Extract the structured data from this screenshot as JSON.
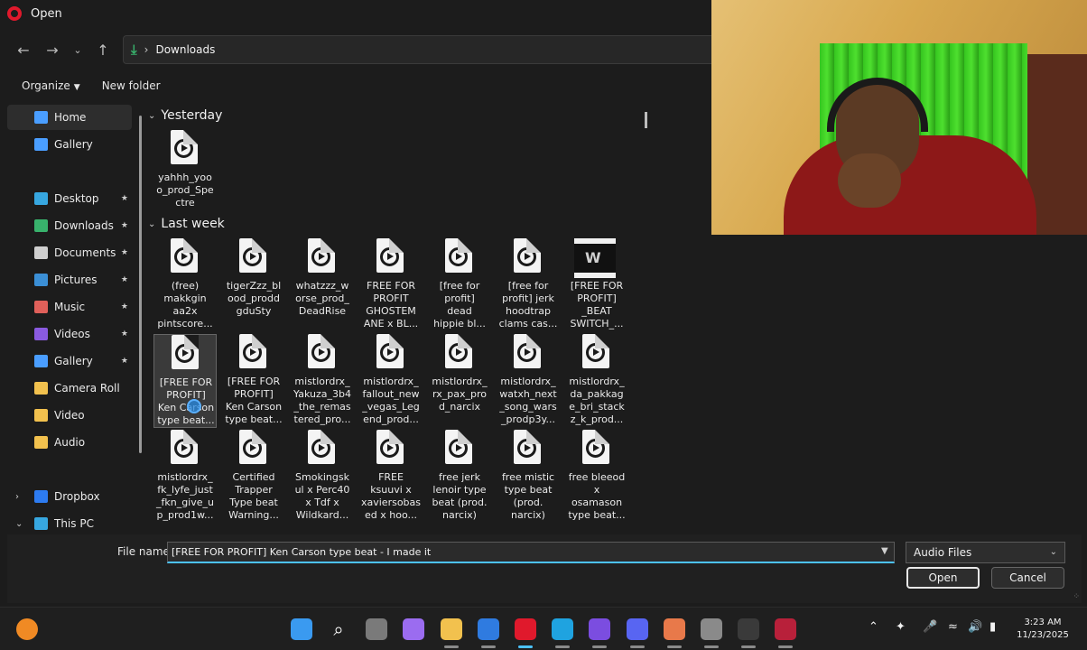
{
  "window": {
    "title": "Open"
  },
  "address": {
    "path": "Downloads"
  },
  "commandbar": {
    "organize": "Organize",
    "new_folder": "New folder"
  },
  "sidebar": {
    "items": [
      {
        "label": "Home",
        "icon": "home-icon",
        "color": "#4a9eff",
        "pinned": false,
        "selected": true
      },
      {
        "label": "Gallery",
        "icon": "gallery-icon",
        "color": "#4a9eff",
        "pinned": false
      },
      {
        "label": "Desktop",
        "icon": "desktop-icon",
        "color": "#37a7e0",
        "pinned": true
      },
      {
        "label": "Downloads",
        "icon": "download-icon",
        "color": "#38b26c",
        "pinned": true
      },
      {
        "label": "Documents",
        "icon": "documents-icon",
        "color": "#cfcfcf",
        "pinned": true
      },
      {
        "label": "Pictures",
        "icon": "pictures-icon",
        "color": "#3b8fd6",
        "pinned": true
      },
      {
        "label": "Music",
        "icon": "music-icon",
        "color": "#e0605a",
        "pinned": true
      },
      {
        "label": "Videos",
        "icon": "videos-icon",
        "color": "#8a5ae0",
        "pinned": true
      },
      {
        "label": "Gallery",
        "icon": "gallery-icon",
        "color": "#4a9eff",
        "pinned": true
      },
      {
        "label": "Camera Roll",
        "icon": "folder-icon",
        "color": "#f2c14e",
        "pinned": false
      },
      {
        "label": "Video",
        "icon": "folder-icon",
        "color": "#f2c14e",
        "pinned": false
      },
      {
        "label": "Audio",
        "icon": "folder-icon",
        "color": "#f2c14e",
        "pinned": false
      },
      {
        "label": "Dropbox",
        "icon": "dropbox-icon",
        "color": "#2d7bf0",
        "pinned": false,
        "expander": "collapsed"
      },
      {
        "label": "This PC",
        "icon": "pc-icon",
        "color": "#37a7e0",
        "pinned": false,
        "expander": "expanded"
      }
    ]
  },
  "groups": [
    {
      "title": "Yesterday",
      "files": [
        "yahhh_yoo\no_prod_Spe\nctre"
      ]
    },
    {
      "title": "Last week",
      "files": [
        "(free)\nmakkgin\naa2x\npintscore...",
        "tigerZzz_bl\nood_prodd\ngduSty",
        "whatzzz_w\norse_prod_\nDeadRise",
        "FREE FOR\nPROFIT\nGHOSTEM\nANE x BL...",
        "[free for\nprofit]\ndead\nhippie bl...",
        "[free for\nprofit] jerk\nhoodtrap\nclams cas...",
        "[FREE FOR\nPROFIT]\n_BEAT\nSWITCH_...",
        "[FREE FOR\nPROFIT]\nKen Carson\ntype beat...",
        "[FREE FOR\nPROFIT]\nKen Carson\ntype beat...",
        "mistlordrx_\nYakuza_3b4\n_the_remas\ntered_pro...",
        "mistlordrx_\nfallout_new\n_vegas_Leg\nend_prod...",
        "mistlordrx_\nrx_pax_pro\nd_narcix",
        "mistlordrx_\nwatxh_next\n_song_wars\n_prodp3y...",
        "mistlordrx_\nda_pakkag\ne_bri_stack\nz_k_prod...",
        "mistlordrx_\nfk_lyfe_just\n_fkn_give_u\np_prod1w...",
        "Certified\nTrapper\nType beat\nWarning...",
        "Smokingsk\nul x Perc40\nx Tdf x\nWildkard...",
        "FREE\nksuuvi x\nxaviersobas\ned x hoo...",
        "free jerk\nlenoir type\nbeat (prod.\nnarcix)",
        "free mistic\ntype beat\n(prod.\nnarcix)",
        "free bleeod\nx\nosamason\ntype beat..."
      ]
    }
  ],
  "footer": {
    "filename_label": "File name:",
    "filename_value": "[FREE FOR PROFIT] Ken Carson type beat - I made it",
    "filetype": "Audio Files",
    "open": "Open",
    "cancel": "Cancel"
  },
  "taskbar": {
    "apps": [
      "start-icon",
      "search-icon",
      "task-view-icon",
      "copilot-icon",
      "file-explorer-icon",
      "outlook-icon",
      "opera-icon",
      "edge-icon",
      "clipchamp-icon",
      "discord-icon",
      "app-icon",
      "camera-icon",
      "obs-icon",
      "app-red-icon"
    ],
    "time": "3:23 AM",
    "date": "11/23/2025"
  }
}
